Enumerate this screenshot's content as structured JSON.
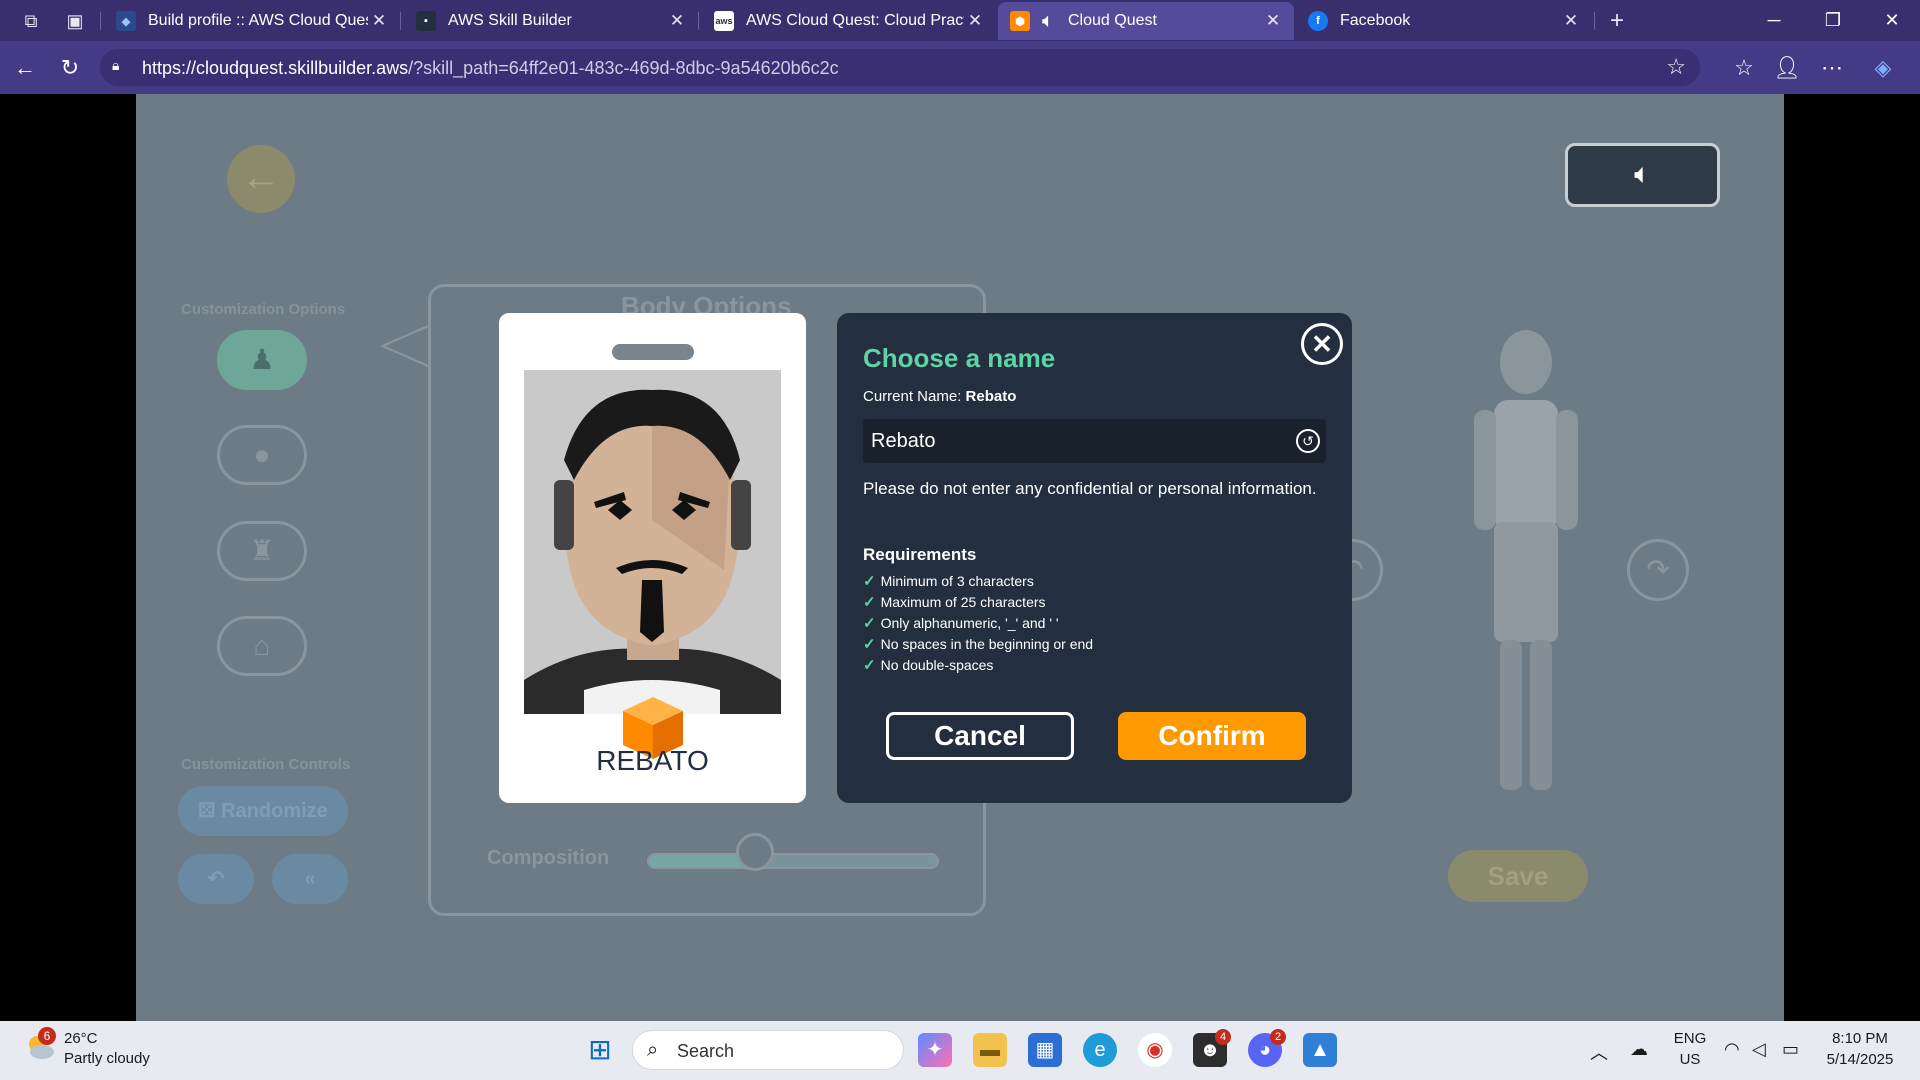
{
  "browser": {
    "tabs": [
      {
        "label": "Build profile :: AWS Cloud Quest: C",
        "favicon": "aws-quest-icon",
        "active": false
      },
      {
        "label": "AWS Skill Builder",
        "favicon": "aws-skill-builder-icon",
        "active": false
      },
      {
        "label": "AWS Cloud Quest: Cloud Practitio",
        "favicon": "aws-icon",
        "active": false
      },
      {
        "label": "Cloud Quest",
        "favicon": "cube-icon",
        "active": true
      },
      {
        "label": "Facebook",
        "favicon": "facebook-icon",
        "active": false
      }
    ],
    "close_glyph": "✕",
    "new_tab_glyph": "+",
    "url_host": "https://cloudquest.skillbuilder.aws",
    "url_path": "/?skill_path=64ff2e01-483c-469d-8dbc-9a54620b6c2c"
  },
  "game": {
    "left_sections": {
      "customization_options": "Customization Options",
      "customization_controls": "Customization Controls",
      "randomize": "Randomize"
    },
    "panel": {
      "title": "Body Options",
      "composition_label": "Composition",
      "composition_level": 0.37
    },
    "save_label": "Save"
  },
  "id_card": {
    "name": "REBATO"
  },
  "dialog": {
    "title": "Choose a name",
    "current_name_label": "Current Name:",
    "current_name_value": "Rebato",
    "input_value": "Rebato",
    "warning": "Please do not enter any confidential or personal information.",
    "requirements_title": "Requirements",
    "requirements": [
      "Minimum of 3 characters",
      "Maximum of 25 characters",
      "Only alphanumeric, '_' and ' '",
      "No spaces in the beginning or end",
      "No double-spaces"
    ],
    "cancel_label": "Cancel",
    "confirm_label": "Confirm",
    "colors": {
      "accent": "#5fd3a5",
      "confirm": "#ff9900",
      "background": "#232f3e"
    }
  },
  "taskbar": {
    "weather_badge": "6",
    "temperature": "26°C",
    "weather": "Partly cloudy",
    "search_placeholder": "Search",
    "teams_badge": "4",
    "discord_badge": "2",
    "language": "ENG",
    "region": "US",
    "time": "8:10 PM",
    "date": "5/14/2025"
  }
}
